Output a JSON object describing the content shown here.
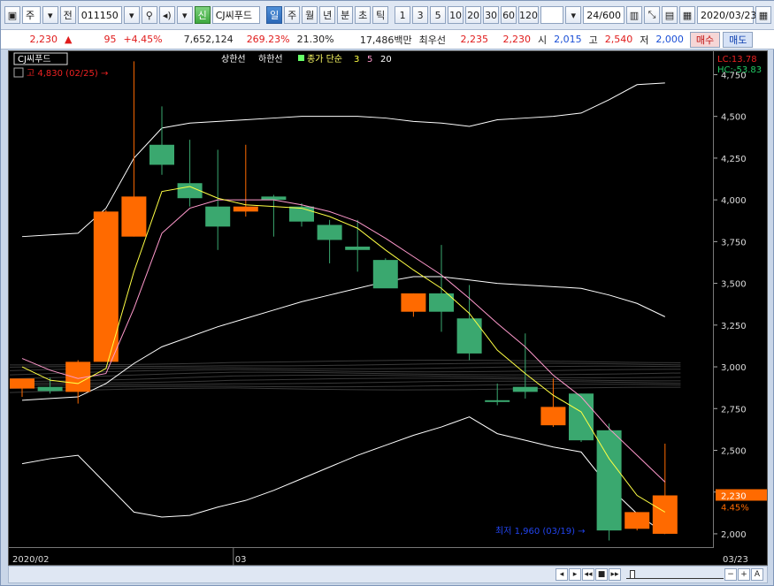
{
  "toolbar": {
    "type_select": "주",
    "jeon_label": "전",
    "code": "011150",
    "sin_label": "신",
    "stock_name": "CJ씨푸드",
    "period_tabs": [
      "일",
      "주",
      "월",
      "년",
      "분",
      "초",
      "틱"
    ],
    "active_period": "일",
    "intervals": [
      "1",
      "3",
      "5",
      "10",
      "20",
      "30",
      "60",
      "120"
    ],
    "count": "24/600",
    "date": "2020/03/23"
  },
  "quote": {
    "price": "2,230",
    "change_arrow": "▲",
    "change": "95",
    "change_pct": "+4.45%",
    "volume": "7,652,124",
    "vol_ratio": "269.23%",
    "turnover": "21.30%",
    "amount": "17,486백만",
    "priority_label": "최우선",
    "ask": "2,235",
    "bid": "2,230",
    "open_label": "시",
    "open": "2,015",
    "high_label": "고",
    "high": "2,540",
    "low_label": "저",
    "low": "2,000",
    "buy_btn": "매수",
    "sell_btn": "매도"
  },
  "colors": {
    "up": "#ff6a00",
    "down": "#3aa86f",
    "bollinger": "#ffffff",
    "ma3": "#ffff44",
    "ma5": "#ff99cc",
    "ma20": "#ffffff",
    "legend_green": "#66ff66",
    "legend_yellow": "#ffff66"
  },
  "chart_data": {
    "type": "candlestick",
    "title_tag": "CJ씨푸드",
    "legend": {
      "upper_limit": "상한선",
      "lower_limit": "하한선",
      "ma_label": "종가 단순",
      "ma_periods": [
        "3",
        "5",
        "20"
      ]
    },
    "high_annotation": "고 4,830 (02/25)",
    "low_annotation": "최저 1,960 (03/19)",
    "lc_label": "LC:13.78",
    "hc_label": "HC:-53.83",
    "last_price_label": "2,230",
    "last_pct_label": "4.45%",
    "y_ticks": [
      2000,
      2250,
      2500,
      2750,
      3000,
      3250,
      3500,
      3750,
      4000,
      4250,
      4500,
      4750
    ],
    "y_tick_labels": [
      "2,000",
      "2,250",
      "2,500",
      "2,750",
      "3,000",
      "3,250",
      "3,500",
      "3,750",
      "4,000",
      "4,250",
      "4,500",
      "4,750"
    ],
    "ylim": [
      1915,
      4890
    ],
    "x_labels": [
      {
        "index": 0,
        "text": "2020/02"
      },
      {
        "index": 8,
        "text": "03"
      },
      {
        "index": 24,
        "text": "03/23"
      }
    ],
    "candles": [
      {
        "o": 2870,
        "h": 2880,
        "l": 2820,
        "c": 2930
      },
      {
        "o": 2880,
        "h": 2935,
        "l": 2840,
        "c": 2855
      },
      {
        "o": 2850,
        "h": 3040,
        "l": 2780,
        "c": 3030
      },
      {
        "o": 3030,
        "h": 3940,
        "l": 3030,
        "c": 3930
      },
      {
        "o": 3780,
        "h": 4830,
        "l": 3780,
        "c": 4020
      },
      {
        "o": 4330,
        "h": 4560,
        "l": 4150,
        "c": 4210
      },
      {
        "o": 4100,
        "h": 4360,
        "l": 3960,
        "c": 4010
      },
      {
        "o": 3960,
        "h": 4300,
        "l": 3700,
        "c": 3840
      },
      {
        "o": 3930,
        "h": 4330,
        "l": 3900,
        "c": 3960
      },
      {
        "o": 4020,
        "h": 4030,
        "l": 3780,
        "c": 4000
      },
      {
        "o": 3960,
        "h": 3980,
        "l": 3840,
        "c": 3870
      },
      {
        "o": 3850,
        "h": 3880,
        "l": 3620,
        "c": 3760
      },
      {
        "o": 3720,
        "h": 3880,
        "l": 3570,
        "c": 3700
      },
      {
        "o": 3640,
        "h": 3650,
        "l": 3480,
        "c": 3470
      },
      {
        "o": 3330,
        "h": 3440,
        "l": 3300,
        "c": 3440
      },
      {
        "o": 3440,
        "h": 3730,
        "l": 3210,
        "c": 3330
      },
      {
        "o": 3290,
        "h": 3490,
        "l": 3040,
        "c": 3080
      },
      {
        "o": 2800,
        "h": 2900,
        "l": 2770,
        "c": 2790
      },
      {
        "o": 2880,
        "h": 3200,
        "l": 2810,
        "c": 2850
      },
      {
        "o": 2650,
        "h": 2930,
        "l": 2640,
        "c": 2760
      },
      {
        "o": 2840,
        "h": 2840,
        "l": 2550,
        "c": 2560
      },
      {
        "o": 2620,
        "h": 2660,
        "l": 1960,
        "c": 2020
      },
      {
        "o": 2030,
        "h": 2130,
        "l": 2020,
        "c": 2130
      },
      {
        "o": 2000,
        "h": 2540,
        "l": 2000,
        "c": 2230
      }
    ],
    "ma3": [
      3000,
      2920,
      2900,
      2990,
      3570,
      4050,
      4080,
      4010,
      3970,
      3960,
      3950,
      3900,
      3830,
      3700,
      3580,
      3470,
      3320,
      3100,
      2960,
      2830,
      2730,
      2450,
      2230,
      2130
    ],
    "ma5": [
      3050,
      2980,
      2930,
      2960,
      3350,
      3800,
      3950,
      4000,
      4000,
      4000,
      3970,
      3930,
      3870,
      3770,
      3660,
      3550,
      3410,
      3260,
      3120,
      2950,
      2820,
      2630,
      2470,
      2310
    ],
    "bb_upper": [
      3780,
      3790,
      3800,
      3950,
      4250,
      4430,
      4460,
      4470,
      4480,
      4490,
      4500,
      4500,
      4500,
      4490,
      4470,
      4460,
      4440,
      4480,
      4490,
      4500,
      4520,
      4600,
      4690,
      4700
    ],
    "bb_mid": [
      2800,
      2810,
      2820,
      2900,
      3020,
      3120,
      3180,
      3240,
      3290,
      3340,
      3390,
      3430,
      3470,
      3510,
      3540,
      3540,
      3520,
      3500,
      3490,
      3480,
      3470,
      3430,
      3380,
      3300
    ],
    "bb_lower": [
      2420,
      2450,
      2470,
      2300,
      2130,
      2100,
      2110,
      2160,
      2200,
      2260,
      2330,
      2400,
      2470,
      2530,
      2590,
      2640,
      2700,
      2600,
      2560,
      2520,
      2490,
      2280,
      2120,
      2000
    ]
  }
}
